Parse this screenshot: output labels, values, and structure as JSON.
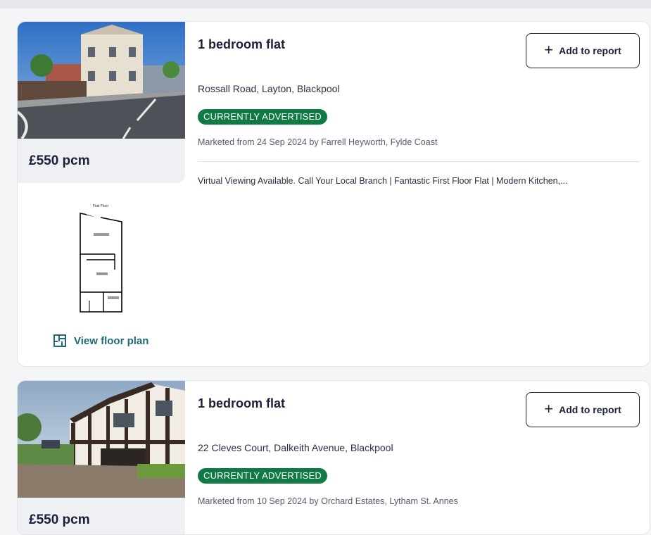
{
  "listings": [
    {
      "title": "1 bedroom flat",
      "add_label": "Add to report",
      "address": "Rossall Road, Layton, Blackpool",
      "badge": "CURRENTLY ADVERTISED",
      "marketed": "Marketed from 24 Sep 2024 by Farrell Heyworth, Fylde Coast",
      "description": "Virtual Viewing Available. Call Your Local Branch | Fantastic First Floor Flat | Modern Kitchen,...",
      "price": "£550 pcm",
      "floor_plan_label": "View floor plan",
      "floor_plan_caption": "First Floor"
    },
    {
      "title": "1 bedroom flat",
      "add_label": "Add to report",
      "address": "22 Cleves Court, Dalkeith Avenue, Blackpool",
      "badge": "CURRENTLY ADVERTISED",
      "marketed": "Marketed from 10 Sep 2024 by Orchard Estates, Lytham St. Annes",
      "price": "£550 pcm"
    }
  ],
  "icons": {
    "add": "plus-icon",
    "floor_plan": "floor-plan-icon"
  },
  "colors": {
    "badge_green": "#0f7a44",
    "link_teal": "#1f6b7a",
    "text_navy": "#1c1f3a"
  }
}
